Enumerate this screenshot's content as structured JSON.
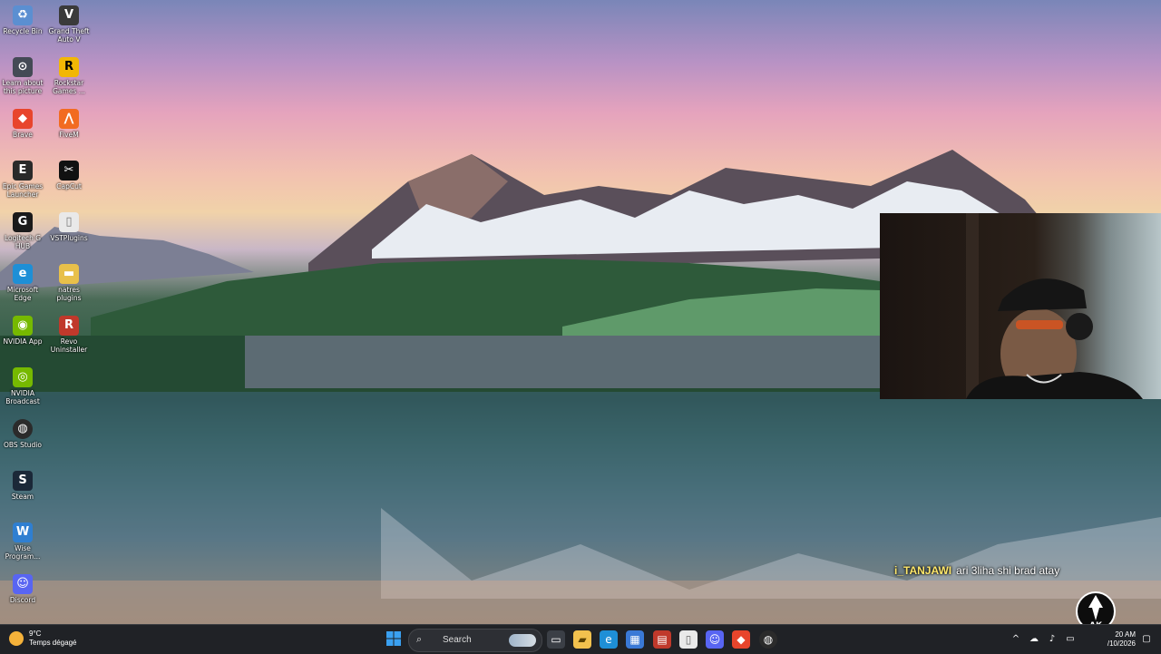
{
  "desktop": {
    "icons": [
      {
        "label": "Recycle Bin",
        "glyph": "♻",
        "color": "#5b8fd1"
      },
      {
        "label": "Grand Theft Auto V",
        "glyph": "V",
        "color": "#3a3a3a"
      },
      {
        "label": "Learn about this picture",
        "glyph": "⊙",
        "color": "#444a55"
      },
      {
        "label": "Rockstar Games ...",
        "glyph": "R",
        "color": "#f2b705"
      },
      {
        "label": "Brave",
        "glyph": "◆",
        "color": "#e8452c"
      },
      {
        "label": "FiveM",
        "glyph": "⋀",
        "color": "#f26b21"
      },
      {
        "label": "Epic Games Launcher",
        "glyph": "E",
        "color": "#2a2a2a"
      },
      {
        "label": "CapCut",
        "glyph": "✂",
        "color": "#111111"
      },
      {
        "label": "Logitech G HUB",
        "glyph": "G",
        "color": "#1a1a1a"
      },
      {
        "label": "VSTPlugins",
        "glyph": "▯",
        "color": "#e9e9e9"
      },
      {
        "label": "Microsoft Edge",
        "glyph": "e",
        "color": "#1e8fd6"
      },
      {
        "label": "natres plugins",
        "glyph": "▬",
        "color": "#e8c04a"
      },
      {
        "label": "NVIDIA App",
        "glyph": "◉",
        "color": "#76b900"
      },
      {
        "label": "Revo Uninstaller",
        "glyph": "R",
        "color": "#c0392b"
      },
      {
        "label": "NVIDIA Broadcast",
        "glyph": "◎",
        "color": "#76b900"
      },
      {
        "label": "OBS Studio",
        "glyph": "◍",
        "color": "#2b2b2b"
      },
      {
        "label": "Steam",
        "glyph": "S",
        "color": "#1b2838"
      },
      {
        "label": "Wise Program...",
        "glyph": "W",
        "color": "#2f7fd1"
      },
      {
        "label": "Discord",
        "glyph": "☺",
        "color": "#5865f2"
      }
    ]
  },
  "chat": {
    "username": "i_TANJAWI",
    "message": "ari 3liha shi brad atay"
  },
  "taskbar": {
    "weather_temp": "9°C",
    "weather_desc": "Temps dégagé",
    "search_label": "Search",
    "start_icon": "windows-start-icon",
    "apps": [
      {
        "name": "task-view-icon",
        "glyph": "▭",
        "color": "#3b3f46"
      },
      {
        "name": "file-explorer-icon",
        "glyph": "▰",
        "color": "#f2c14e"
      },
      {
        "name": "edge-icon",
        "glyph": "e",
        "color": "#1e8fd6"
      },
      {
        "name": "microsoft-store-icon",
        "glyph": "▦",
        "color": "#3a79d6"
      },
      {
        "name": "app-red-icon",
        "glyph": "▤",
        "color": "#c0392b"
      },
      {
        "name": "document-icon",
        "glyph": "▯",
        "color": "#e9e9e9"
      },
      {
        "name": "discord-icon",
        "glyph": "☺",
        "color": "#5865f2"
      },
      {
        "name": "brave-icon",
        "glyph": "◆",
        "color": "#e8452c"
      },
      {
        "name": "obs-icon",
        "glyph": "◍",
        "color": "#2b2b2b"
      }
    ],
    "tray": {
      "chevron": "^",
      "clock_time": "20 AM",
      "clock_date": "/10/2026"
    }
  },
  "overlay": {
    "logo_text": "AK"
  }
}
